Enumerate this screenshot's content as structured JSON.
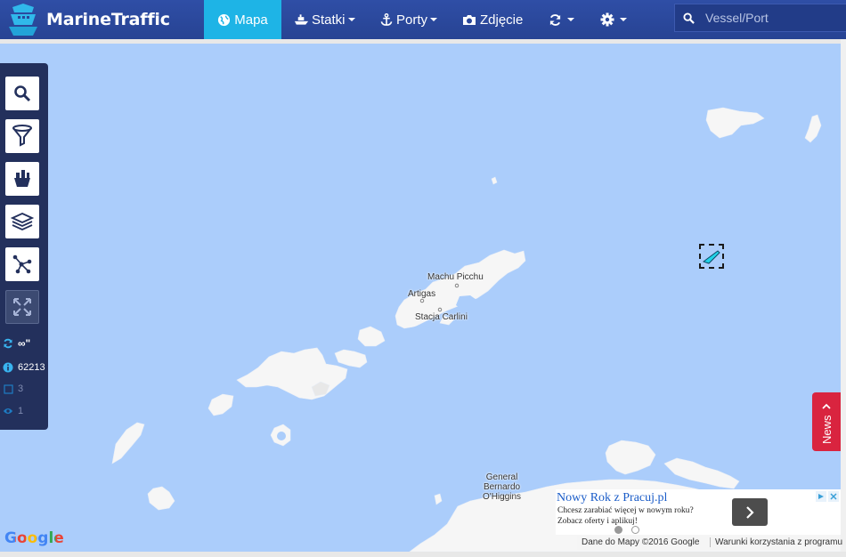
{
  "app": {
    "name": "MarineTraffic"
  },
  "nav": {
    "map_label": "Mapa",
    "ships_label": "Statki",
    "ports_label": "Porty",
    "photo_label": "Zdjęcie"
  },
  "search": {
    "placeholder": "Vessel/Port"
  },
  "panel": {
    "refresh_value": "∞\"",
    "info_count": "62213",
    "selected_count": "3",
    "visible_count": "1"
  },
  "map": {
    "places": {
      "machu_picchu": "Machu Picchu",
      "artigas": "Artigas",
      "carlini": "Stacja Carlini",
      "ohiggins": "General\nBernardo\nO'Higgins"
    },
    "ohiggins_lines": [
      "General",
      "Bernardo",
      "O'Higgins"
    ],
    "google_logo": "Google",
    "attribution": "Dane do Mapy ©2016 Google",
    "terms": "Warunki korzystania z programu"
  },
  "news": {
    "label": "News"
  },
  "ad": {
    "title": "Nowy Rok z Pracuj.pl",
    "line1": "Chcesz zarabiać więcej w nowym roku?",
    "line2": "Zobacz oferty i aplikuj!"
  },
  "colors": {
    "nav_bg": "#2a4699",
    "active_tab": "#1eb4e6",
    "sea": "#abcdfb",
    "land": "#f5f5f5",
    "panel": "#23305c",
    "news": "#d9243f"
  }
}
